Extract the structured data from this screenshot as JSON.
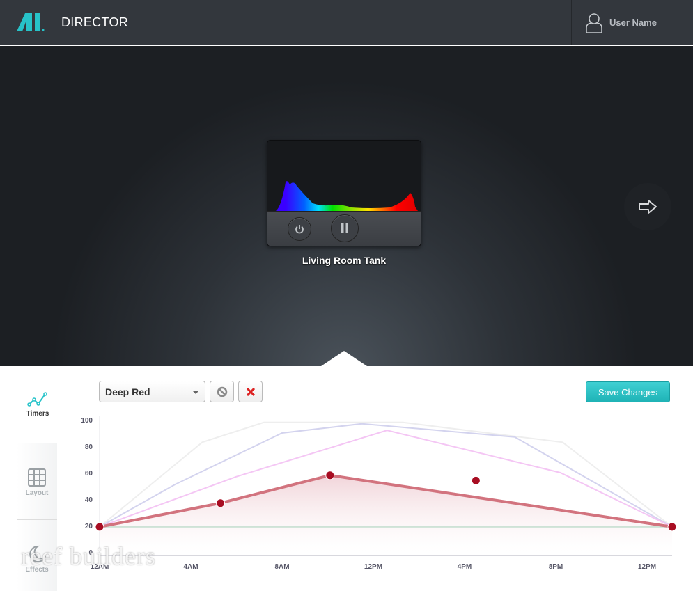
{
  "header": {
    "title": "DIRECTOR",
    "logo": "AI",
    "user_name": "User Name",
    "user_icon": "user-icon"
  },
  "device": {
    "name": "Living Room Tank",
    "power_icon": "power-icon",
    "pause_icon": "pause-icon"
  },
  "next_icon": "arrow-right-icon",
  "sidebar": {
    "items": [
      {
        "label": "Timers",
        "icon": "chart-line-icon",
        "active": true
      },
      {
        "label": "Layout",
        "icon": "grid-icon"
      },
      {
        "label": "Effects",
        "icon": "moon-stars-icon"
      }
    ]
  },
  "toolbar": {
    "channel_select": "Deep Red",
    "disable_icon": "block-icon",
    "delete_icon": "close-icon",
    "save_label": "Save Changes"
  },
  "watermark": "reef builders",
  "chart_data": {
    "type": "line",
    "y_ticks": [
      "100",
      "80",
      "60",
      "40",
      "20",
      "0"
    ],
    "x_ticks": [
      "12AM",
      "4AM",
      "8AM",
      "12PM",
      "4PM",
      "8PM",
      "12PM"
    ],
    "ylim": [
      0,
      100
    ],
    "xlim_hours": [
      0,
      25.1
    ],
    "series": [
      {
        "color": "#eeeeee",
        "points": [
          [
            0,
            19
          ],
          [
            4.5,
            83
          ],
          [
            7.2,
            98
          ],
          [
            13.3,
            98
          ],
          [
            20.3,
            83
          ],
          [
            25.1,
            19
          ]
        ]
      },
      {
        "color": "#d3d3ee",
        "points": [
          [
            0,
            19
          ],
          [
            3.3,
            51
          ],
          [
            8,
            90
          ],
          [
            11.5,
            97
          ],
          [
            18.2,
            87
          ],
          [
            25.1,
            19
          ]
        ]
      },
      {
        "color": "#f4c6f4",
        "points": [
          [
            0,
            19
          ],
          [
            6,
            57
          ],
          [
            12.6,
            92
          ],
          [
            20.2,
            60
          ],
          [
            25.1,
            19
          ]
        ]
      },
      {
        "color": "#b9e0cc",
        "points": [
          [
            0,
            19
          ],
          [
            25.1,
            19
          ]
        ]
      },
      {
        "color": "#d2737e",
        "selected": true,
        "points": [
          [
            0,
            19
          ],
          [
            5.3,
            37
          ],
          [
            10.1,
            58
          ],
          [
            25.1,
            19
          ]
        ],
        "handles": [
          [
            0,
            19
          ],
          [
            5.3,
            37
          ],
          [
            10.1,
            58
          ],
          [
            16.5,
            54
          ],
          [
            25.1,
            19
          ]
        ]
      }
    ]
  }
}
